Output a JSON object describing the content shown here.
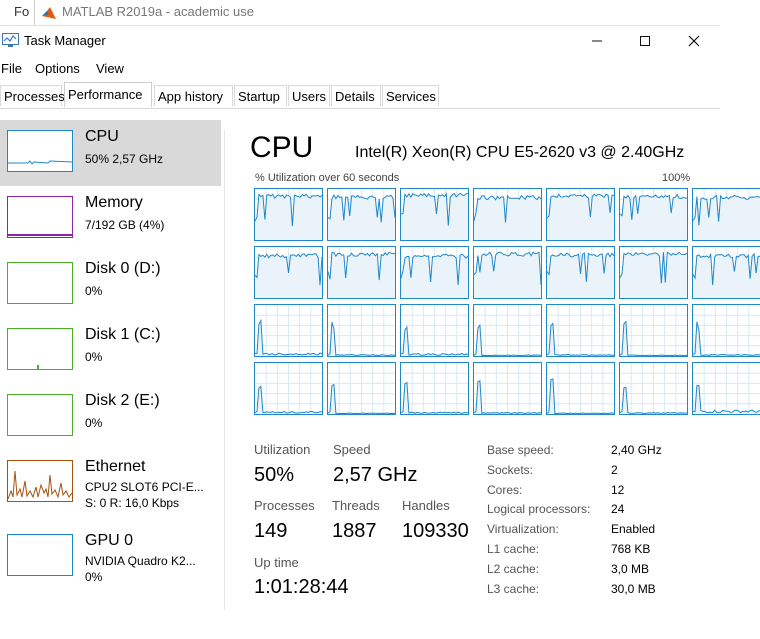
{
  "background_window": {
    "fragment": "Fo",
    "title": "MATLAB R2019a - academic use"
  },
  "window": {
    "title": "Task Manager",
    "icons": [
      "task-manager-icon",
      "minimize-icon",
      "maximize-icon",
      "close-icon"
    ]
  },
  "menu": [
    "File",
    "Options",
    "View"
  ],
  "tabs": [
    "Processes",
    "Performance",
    "App history",
    "Startup",
    "Users",
    "Details",
    "Services"
  ],
  "active_tab": "Performance",
  "colors": {
    "cpu": "#1f88c9",
    "memory": "#8e24aa",
    "disk": "#4caf2a",
    "ethernet": "#a7520f",
    "gpu": "#1f88c9",
    "selected": "#d9d9d9"
  },
  "sidebar": [
    {
      "name": "CPU",
      "sub1": "50% 2,57 GHz",
      "sub2": ""
    },
    {
      "name": "Memory",
      "sub1": "7/192 GB (4%)",
      "sub2": ""
    },
    {
      "name": "Disk 0 (D:)",
      "sub1": "0%",
      "sub2": ""
    },
    {
      "name": "Disk 1 (C:)",
      "sub1": "0%",
      "sub2": ""
    },
    {
      "name": "Disk 2 (E:)",
      "sub1": "0%",
      "sub2": ""
    },
    {
      "name": "Ethernet",
      "sub1": "CPU2 SLOT6 PCI-E...",
      "sub2": "S: 0 R: 16,0 Kbps"
    },
    {
      "name": "GPU 0",
      "sub1": "NVIDIA Quadro K2...",
      "sub2": "0%"
    }
  ],
  "cpu": {
    "title": "CPU",
    "model": "Intel(R) Xeon(R) CPU E5-2620 v3 @ 2.40GHz",
    "graph_label": "% Utilization over 60 seconds",
    "graph_max": "100%",
    "core_levels": [
      0.9,
      0.88,
      0.92,
      0.87,
      0.9,
      0.89,
      0.88,
      0.87,
      0.9,
      0.86,
      0.9,
      0.88,
      0.9,
      0.87,
      0.06,
      0.03,
      0.05,
      0.02,
      0.03,
      0.02,
      0.03,
      0.05,
      0.02,
      0.04,
      0.03,
      0.02,
      0.03,
      0.08
    ],
    "stats": {
      "utilization_label": "Utilization",
      "utilization": "50%",
      "speed_label": "Speed",
      "speed": "2,57 GHz",
      "processes_label": "Processes",
      "processes": "149",
      "threads_label": "Threads",
      "threads": "1887",
      "handles_label": "Handles",
      "handles": "109330",
      "uptime_label": "Up time",
      "uptime": "1:01:28:44"
    },
    "specs": [
      {
        "label": "Base speed:",
        "value": "2,40 GHz"
      },
      {
        "label": "Sockets:",
        "value": "2"
      },
      {
        "label": "Cores:",
        "value": "12"
      },
      {
        "label": "Logical processors:",
        "value": "24"
      },
      {
        "label": "Virtualization:",
        "value": "Enabled"
      },
      {
        "label": "L1 cache:",
        "value": "768 KB"
      },
      {
        "label": "L2 cache:",
        "value": "3,0 MB"
      },
      {
        "label": "L3 cache:",
        "value": "30,0 MB"
      }
    ]
  }
}
